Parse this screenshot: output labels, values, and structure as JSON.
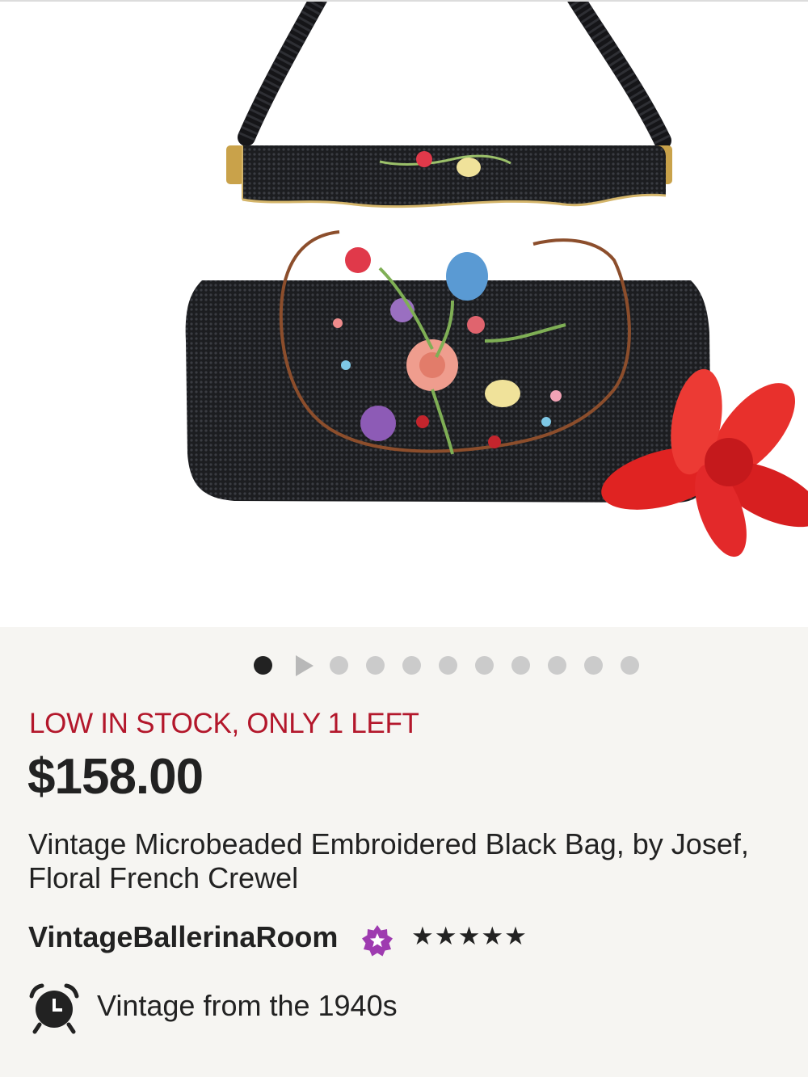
{
  "product_image": {
    "alt": "Vintage Microbeaded Embroidered Black Bag"
  },
  "carousel": {
    "total_items": 11,
    "active_index": 0,
    "video_index": 1
  },
  "stock_notice": "LOW IN STOCK, ONLY 1 LEFT",
  "price": "$158.00",
  "title_lines": [
    "Vintage Microbeaded Embroidered Black Bag, by Josef,",
    "Floral French Crewel"
  ],
  "shop": {
    "name": "VintageBallerinaRoom",
    "badge_icon": "star-seller-badge-icon",
    "rating": 5,
    "stars": "★★★★★"
  },
  "vintage": {
    "icon": "alarm-clock-icon",
    "text": "Vintage from the 1940s"
  },
  "colors": {
    "stock_red": "#b3172b",
    "star_seller_purple": "#9e3bb0",
    "text": "#222222",
    "panel_bg": "#f6f5f2"
  }
}
